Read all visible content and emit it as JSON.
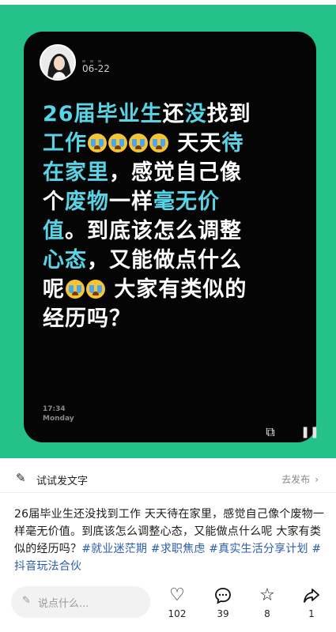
{
  "post": {
    "date": "06-22",
    "headline": [
      {
        "t": "26届毕业生",
        "hl": true
      },
      {
        "t": "还"
      },
      {
        "t": "没",
        "hl": true
      },
      {
        "t": "找到"
      },
      {
        "br": true
      },
      {
        "t": "工作",
        "hl": true
      },
      {
        "emoji": 4
      },
      {
        "t": " 天天"
      },
      {
        "t": "待",
        "hl": true
      },
      {
        "br": true
      },
      {
        "t": "在家里",
        "hl": true
      },
      {
        "t": "，感觉自己像"
      },
      {
        "br": true
      },
      {
        "t": "个"
      },
      {
        "t": "废物",
        "hl": true
      },
      {
        "t": "一样"
      },
      {
        "t": "毫无价",
        "hl": true
      },
      {
        "br": true
      },
      {
        "t": "值",
        "hl": true
      },
      {
        "t": "。到底该怎么调整"
      },
      {
        "br": true
      },
      {
        "t": "心态",
        "hl": true
      },
      {
        "t": "，又能做点什么"
      },
      {
        "br": true
      },
      {
        "t": "呢"
      },
      {
        "emoji": 2
      },
      {
        "t": " 大家有类似的"
      },
      {
        "br": true
      },
      {
        "t": "经历吗？"
      }
    ],
    "time": "17:34",
    "weekday": "Monday"
  },
  "draft_bar": {
    "label": "试试发文字",
    "publish": "去发布"
  },
  "caption": {
    "text": "26届毕业生还没找到工作 天天待在家里，感觉自己像个废物一样毫无价值。到底该怎么调整心态，又能做点什么呢 大家有类似的经历吗？",
    "tags": [
      "#就业迷茫期",
      "#求职焦虑",
      "#真实生活分享计划",
      "#抖音玩法合伙"
    ]
  },
  "bottom_bar": {
    "comment_placeholder": "说点什么...",
    "likes": "102",
    "comments": "39",
    "favorites": "8",
    "shares": "1"
  },
  "colors": {
    "background_green": "#25c18a",
    "card": "#050505",
    "highlight": "#58d4e6",
    "hashtag": "#2c5da8"
  },
  "icons": {
    "draft": "pencil-icon",
    "comment_field": "pencil-icon",
    "like": "heart-icon",
    "comment": "comment-bubble-icon",
    "favorite": "star-icon",
    "share": "share-arrow-icon",
    "screen": "screen-scan-icon",
    "pause": "pause-icon"
  }
}
